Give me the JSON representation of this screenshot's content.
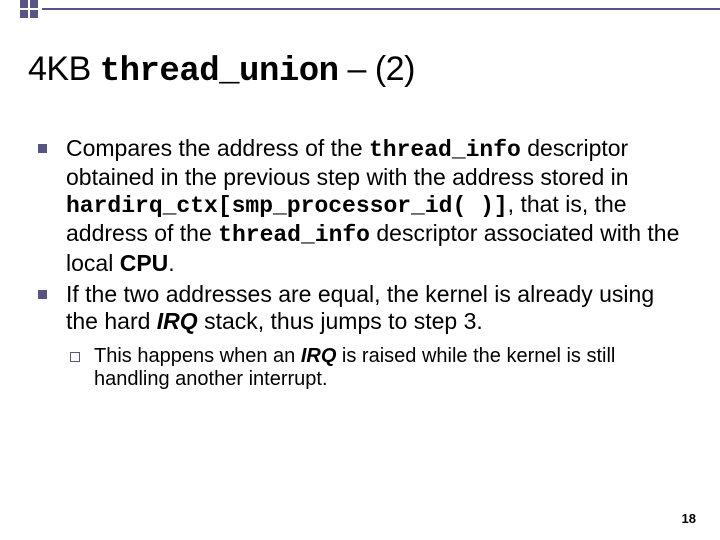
{
  "title": {
    "prefix": "4KB ",
    "mono": "thread_union",
    "suffix": " – (2)"
  },
  "bullets": [
    {
      "parts": [
        {
          "text": "Compares the address of the "
        },
        {
          "text": "thread_info",
          "mono": true
        },
        {
          "text": " descriptor obtained in the previous step with the address stored in "
        },
        {
          "text": "hardirq_ctx[smp_processor_id( )]",
          "mono": true
        },
        {
          "text": ", that is, the address of the "
        },
        {
          "text": "thread_info",
          "mono": true
        },
        {
          "text": " descriptor associated with the local "
        },
        {
          "text": "CPU",
          "bold": true
        },
        {
          "text": "."
        }
      ]
    },
    {
      "parts": [
        {
          "text": "If the two addresses are equal, the kernel is already using the hard "
        },
        {
          "text": "IRQ",
          "bold": true,
          "italic": true
        },
        {
          "text": " stack, thus jumps to step 3."
        }
      ]
    }
  ],
  "sub_bullets": [
    {
      "parts": [
        {
          "text": "This happens when an "
        },
        {
          "text": "IRQ",
          "bold": true,
          "italic": true
        },
        {
          "text": " is raised while the kernel is still handling another interrupt."
        }
      ]
    }
  ],
  "page_number": "18"
}
